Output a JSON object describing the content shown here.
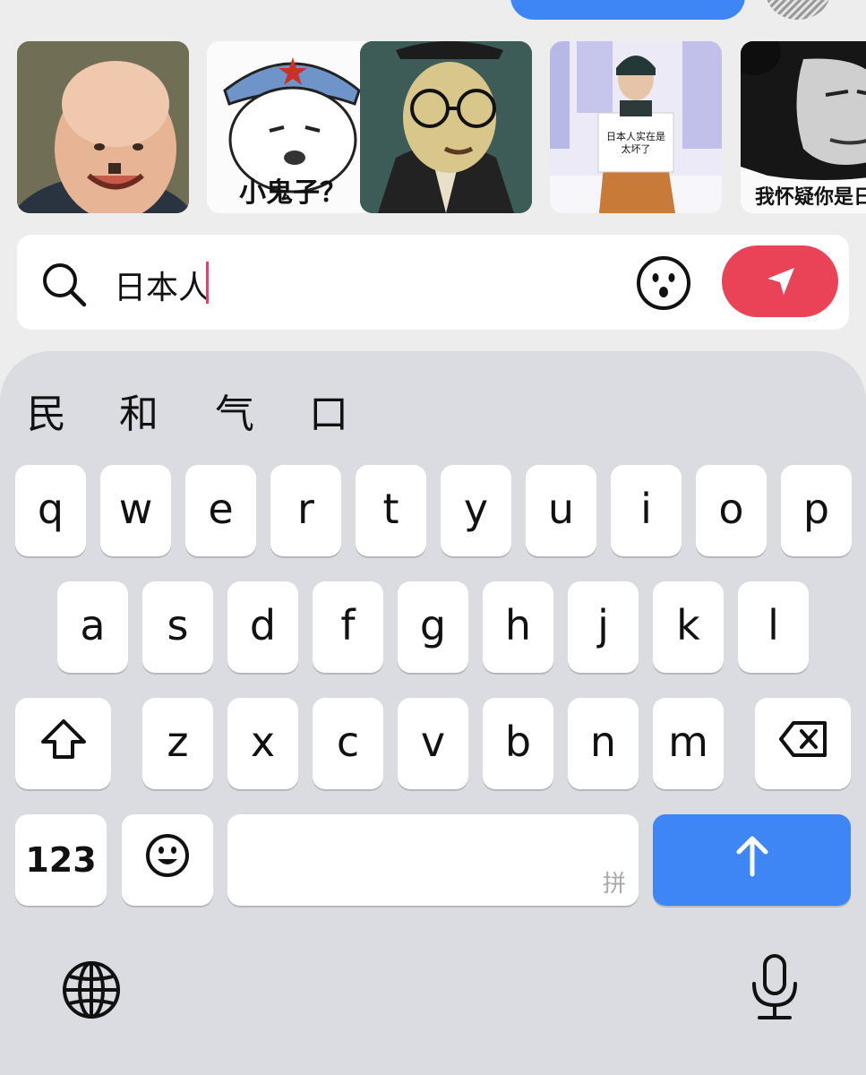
{
  "stickers": [
    {
      "name": "bald-baby-sticker",
      "caption": ""
    },
    {
      "name": "soldier-cartoon-sticker",
      "caption": "小鬼子？"
    },
    {
      "name": "glasses-man-sticker",
      "caption": ""
    },
    {
      "name": "sign-holder-sticker",
      "sign_line1": "日本人实在是",
      "sign_line2": "太坏了"
    },
    {
      "name": "panda-face-sticker",
      "caption": "我怀疑你是日"
    }
  ],
  "search": {
    "query": "日本人",
    "icon": "search-icon",
    "emoji_icon": "emoji-face-icon",
    "send_icon": "paper-plane-icon",
    "accent_color": "#ea4257"
  },
  "keyboard": {
    "candidates": [
      "民",
      "和",
      "气",
      "口"
    ],
    "row1": [
      "q",
      "w",
      "e",
      "r",
      "t",
      "y",
      "u",
      "i",
      "o",
      "p"
    ],
    "row2": [
      "a",
      "s",
      "d",
      "f",
      "g",
      "h",
      "j",
      "k",
      "l"
    ],
    "row3": [
      "z",
      "x",
      "c",
      "v",
      "b",
      "n",
      "m"
    ],
    "numbers_label": "123",
    "space_hint": "拼",
    "shift_icon": "shift-arrow-icon",
    "delete_icon": "backspace-icon",
    "emoji_key_icon": "smiley-icon",
    "return_icon": "up-arrow-icon",
    "globe_icon": "globe-icon",
    "mic_icon": "microphone-icon",
    "return_color": "#3e86f5"
  }
}
